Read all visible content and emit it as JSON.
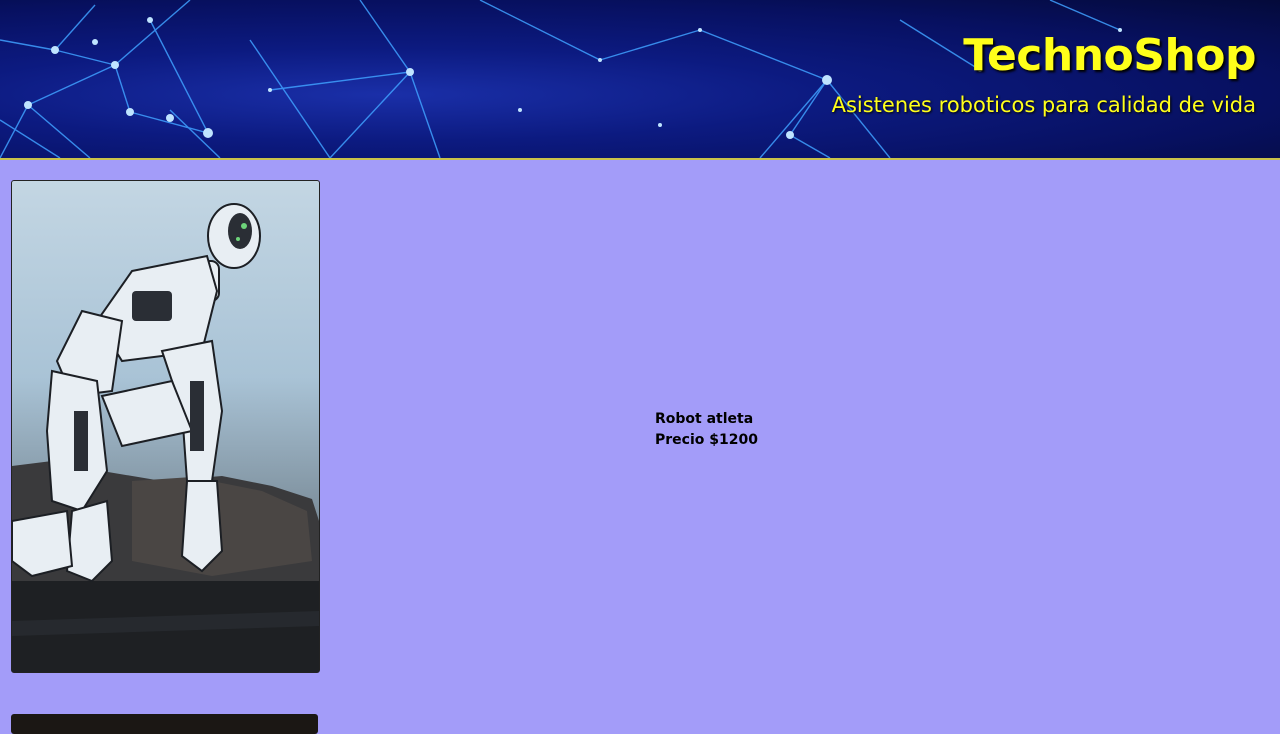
{
  "header": {
    "title": "TechnoShop",
    "subtitle": "Asistenes roboticos para calidad de vida"
  },
  "products": [
    {
      "name": "Robot atleta",
      "price_label": "Precio $1200",
      "image": "robot-athlete-kneeling-photo"
    }
  ],
  "colors": {
    "page_background": "#a39cf9",
    "header_background": "#0c1a80",
    "brand_text": "#ffff1a",
    "header_border": "#c9c24a"
  }
}
